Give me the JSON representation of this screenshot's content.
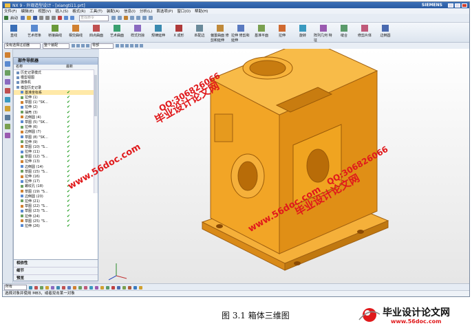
{
  "window": {
    "title": "NX 9 - 外观造型设计 - [xiangti11.prt]",
    "brand": "SIEMENS"
  },
  "menu": [
    "文件(F)",
    "编辑(E)",
    "视图(V)",
    "插入(S)",
    "格式(R)",
    "工具(T)",
    "装配(A)",
    "信息(I)",
    "分析(L)",
    "首选项(P)",
    "窗口(O)",
    "帮助(H)"
  ],
  "toolbar": {
    "start_label": "启动",
    "search_placeholder": "查找命令"
  },
  "ribbon": [
    {
      "label": "直线",
      "color": "#3a6fb8"
    },
    {
      "label": "艺术样条",
      "color": "#5a8ad0"
    },
    {
      "label": "桥接曲线",
      "color": "#6a9a3a"
    },
    {
      "label": "相交曲线",
      "color": "#d08030"
    },
    {
      "label": "四点曲面",
      "color": "#c05050"
    },
    {
      "label": "艺术曲面",
      "color": "#3aa070"
    },
    {
      "label": "样式扫掠",
      "color": "#8a6ac0"
    },
    {
      "label": "规律延伸",
      "color": "#3a8ab0"
    },
    {
      "label": "X 成形",
      "color": "#b03a3a"
    },
    {
      "label": "匹配边",
      "color": "#6a8a9a"
    },
    {
      "label": "偏置曲面 修剪和延伸",
      "color": "#c08a3a"
    },
    {
      "label": "拉伸 修剪和延伸",
      "color": "#5a7ac0"
    },
    {
      "label": "基准平面",
      "color": "#7aa050"
    },
    {
      "label": "拉伸",
      "color": "#d06a30"
    },
    {
      "label": "旋转",
      "color": "#3a9ac0"
    },
    {
      "label": "阵列几何 特征",
      "color": "#9a5ab0"
    },
    {
      "label": "缝合",
      "color": "#5a9a6a"
    },
    {
      "label": "修剪片体",
      "color": "#c05a7a"
    },
    {
      "label": "边倒圆",
      "color": "#4a6ab0"
    }
  ],
  "filterbar": {
    "filter": "没有选择过滤器",
    "scope": "整个装配",
    "part": "零部"
  },
  "navigator": {
    "title": "部件导航器",
    "col_name": "名称",
    "col_latest": "最新",
    "items": [
      {
        "label": "历史记录模式",
        "check": ""
      },
      {
        "label": "模型视图",
        "check": ""
      },
      {
        "label": "摄像机",
        "check": ""
      },
      {
        "label": "模型历史记录",
        "check": ""
      },
      {
        "label": "基准坐标系",
        "check": "✔"
      },
      {
        "label": "拉伸 (1)",
        "check": "✔"
      },
      {
        "label": "草图 (1) \"SK...",
        "check": "✔"
      },
      {
        "label": "拉伸 (2)",
        "check": "✔"
      },
      {
        "label": "抽壳 (3)",
        "check": "✔"
      },
      {
        "label": "边倒圆 (4)",
        "check": "✔"
      },
      {
        "label": "草图 (5) \"SK...",
        "check": "✔"
      },
      {
        "label": "拉伸 (6)",
        "check": "✔"
      },
      {
        "label": "边倒圆 (7)",
        "check": "✔"
      },
      {
        "label": "草图 (8) \"SK...",
        "check": "✔"
      },
      {
        "label": "拉伸 (9)",
        "check": "✔"
      },
      {
        "label": "草图 (10) \"S...",
        "check": "✔"
      },
      {
        "label": "拉伸 (11)",
        "check": "✔"
      },
      {
        "label": "草图 (12) \"S...",
        "check": "✔"
      },
      {
        "label": "拉伸 (13)",
        "check": "✔"
      },
      {
        "label": "边倒圆 (14)",
        "check": "✔"
      },
      {
        "label": "草图 (15) \"S...",
        "check": "✔"
      },
      {
        "label": "拉伸 (16)",
        "check": "✔"
      },
      {
        "label": "拉伸 (17)",
        "check": "✔"
      },
      {
        "label": "螺纹孔 (18)",
        "check": "✔"
      },
      {
        "label": "草图 (19) \"S...",
        "check": "✔"
      },
      {
        "label": "边倒圆 (20)",
        "check": "✔"
      },
      {
        "label": "拉伸 (21)",
        "check": "✔"
      },
      {
        "label": "草图 (22) \"S...",
        "check": "✔"
      },
      {
        "label": "草图 (23) \"S...",
        "check": "✔"
      },
      {
        "label": "拉伸 (24)",
        "check": "✔"
      },
      {
        "label": "草图 (25) \"S...",
        "check": "✔"
      },
      {
        "label": "拉伸 (26)",
        "check": "✔"
      }
    ],
    "footer": [
      "相依性",
      "细节",
      "预览"
    ]
  },
  "bottombar": {
    "filter": "所有"
  },
  "status": "选择对象并使用 MB3，或者双击某一对象",
  "watermarks": {
    "site_name": "毕业设计论文网",
    "url": "www.56doc.com",
    "qq": "QQ:306826066"
  },
  "caption": "图 3.1 箱体三维图",
  "corner_logo": {
    "title": "毕业设计论文网",
    "url": "www.56doc.com"
  },
  "colors": {
    "part": "#f0a820",
    "watermark": "#e0191b",
    "titlebar": "#2a5aa0"
  }
}
